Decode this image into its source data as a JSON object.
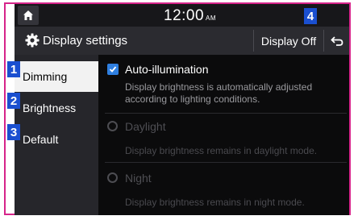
{
  "status_bar": {
    "time": "12:00",
    "ampm": "AM"
  },
  "title_bar": {
    "title": "Display settings",
    "display_off_label": "Display Off"
  },
  "callouts": [
    "1",
    "2",
    "3",
    "4"
  ],
  "sidebar": {
    "items": [
      {
        "label": "Dimming",
        "active": true
      },
      {
        "label": "Brightness",
        "active": false
      },
      {
        "label": "Default",
        "active": false
      }
    ]
  },
  "options": [
    {
      "label": "Auto-illumination",
      "description": "Display brightness is automatically adjusted according to lighting conditions.",
      "control": "checkbox",
      "checked": true,
      "enabled": true
    },
    {
      "label": "Daylight",
      "description": "Display brightness remains in daylight mode.",
      "control": "radio",
      "checked": false,
      "enabled": false
    },
    {
      "label": "Night",
      "description": "Display brightness remains in night mode.",
      "control": "radio",
      "checked": false,
      "enabled": false
    }
  ],
  "icons": {
    "home": "home-icon",
    "settings": "gear-icon",
    "back": "back-arrow-icon",
    "check": "check-icon"
  },
  "colors": {
    "frame": "#d6248a",
    "callout": "#1a4fd0",
    "accent": "#2f7fe0"
  }
}
